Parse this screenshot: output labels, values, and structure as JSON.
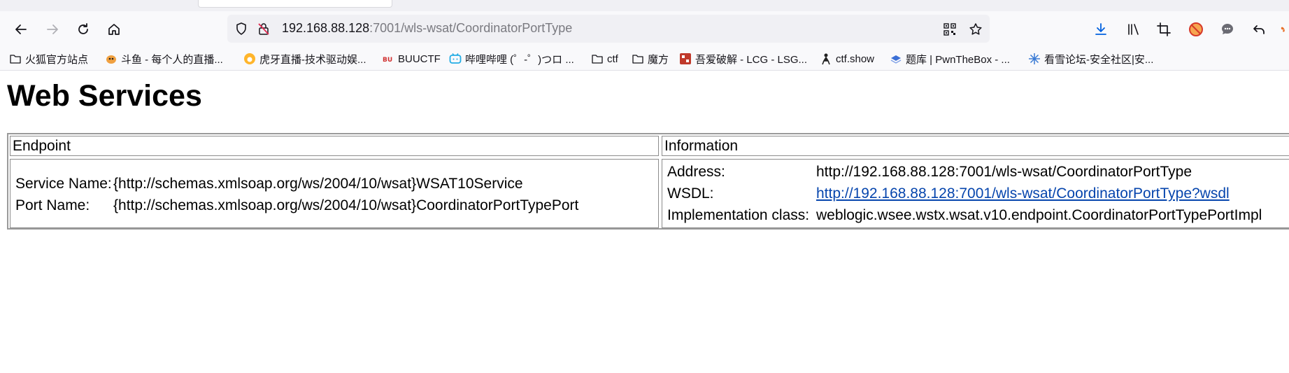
{
  "browser": {
    "url_host": "192.168.88.128",
    "url_path": ":7001/wls-wsat/CoordinatorPortType",
    "bookmarks": [
      {
        "label": "火狐官方站点",
        "icon": "folder-icon"
      },
      {
        "label": "斗鱼 - 每个人的直播...",
        "icon": "douyu-icon"
      },
      {
        "label": "虎牙直播-技术驱动娱...",
        "icon": "huya-icon"
      },
      {
        "label": "BUUCTF",
        "icon": "buuctf-icon"
      },
      {
        "label": "哔哩哔哩 (゜-゜)つロ ...",
        "icon": "bilibili-icon"
      },
      {
        "label": "ctf",
        "icon": "folder-icon"
      },
      {
        "label": "魔方",
        "icon": "folder-icon"
      },
      {
        "label": "吾爱破解 - LCG - LSG...",
        "icon": "52pojie-icon"
      },
      {
        "label": "ctf.show",
        "icon": "ctfshow-icon"
      },
      {
        "label": "题库 | PwnTheBox - ...",
        "icon": "pwnthebox-icon"
      },
      {
        "label": "看雪论坛-安全社区|安...",
        "icon": "kanxue-icon"
      }
    ]
  },
  "page": {
    "title": "Web Services",
    "table": {
      "headers": [
        "Endpoint",
        "Information"
      ],
      "service_name_label": "Service Name:",
      "service_name_value": "{http://schemas.xmlsoap.org/ws/2004/10/wsat}WSAT10Service",
      "port_name_label": "Port Name:",
      "port_name_value": "{http://schemas.xmlsoap.org/ws/2004/10/wsat}CoordinatorPortTypePort",
      "address_label": "Address:",
      "address_value": "http://192.168.88.128:7001/wls-wsat/CoordinatorPortType",
      "wsdl_label": "WSDL:",
      "wsdl_value": "http://192.168.88.128:7001/wls-wsat/CoordinatorPortType?wsdl",
      "impl_label": "Implementation class:",
      "impl_value": "weblogic.wsee.wstx.wsat.v10.endpoint.CoordinatorPortTypePortImpl"
    }
  },
  "colors": {
    "link": "#0645ad",
    "download_accent": "#0060df",
    "toolbar_bg": "#f9f9fb",
    "urlbar_bg": "#f0f0f4"
  }
}
